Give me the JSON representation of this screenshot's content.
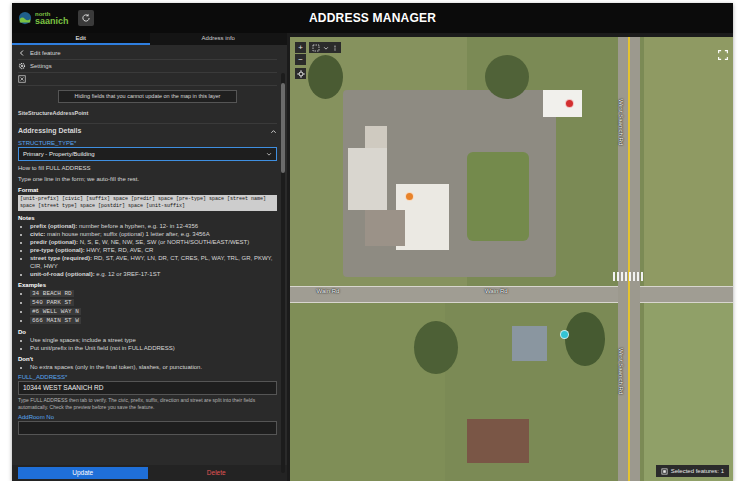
{
  "header": {
    "logo_top": "north",
    "logo_bottom": "saanich",
    "title": "ADDRESS MANAGER"
  },
  "panel": {
    "tabs": [
      {
        "label": "Edit",
        "selected": true
      },
      {
        "label": "Address info",
        "selected": false
      }
    ],
    "back_label": "Edit feature",
    "settings_label": "Settings",
    "notice": "Hiding fields that you cannot update on the map in this layer",
    "layer_name": "SiteStructureAddressPoint",
    "section": {
      "title": "Addressing Details",
      "expanded": true
    },
    "structure_type": {
      "label": "STRUCTURE_TYPE*",
      "value": "Primary - Property/Building"
    },
    "help": {
      "title": "How to fill FULL ADDRESS",
      "intro": "Type one line in the form; we auto-fill the rest.",
      "format_heading": "Format",
      "format": "[unit-prefix] [civic] [suffix] space [predir] space [pre-type] space [street name] space [street type] space [postdir] space [unit-suffix]",
      "notes_heading": "Notes",
      "notes": [
        {
          "term": "prefix (optional):",
          "text": " number before a hyphen, e.g. 12- in 12-4356"
        },
        {
          "term": "civic:",
          "text": " main house number; suffix (optional) 1 letter after, e.g. 3456A"
        },
        {
          "term": "predir (optional):",
          "text": " N, S, E, W, NE, NW, SE, SW (or NORTH/SOUTH/EAST/WEST)"
        },
        {
          "term": "pre-type (optional):",
          "text": " HWY, RTE, RD, AVE, CR"
        },
        {
          "term": "street type (required):",
          "text": " RD, ST, AVE, HWY, LN, DR, CT, CRES, PL, WAY, TRL, GR, PKWY, CIR, HWY"
        },
        {
          "term": "unit-of-road (optional):",
          "text": " e.g. 12 or 3REF-17-1ST"
        }
      ],
      "examples_heading": "Examples",
      "examples": [
        "34 BEACH RD",
        "540 PARK ST",
        "#6 WELL WAY N",
        "666 MAIN ST W"
      ],
      "do_heading": "Do",
      "do": [
        "Use single spaces; include a street type",
        "Put unit/prefix in the Unit field (not in FULL ADDRESS)"
      ],
      "dont_heading": "Don't",
      "dont": [
        "No extra spaces (only in the final token), slashes, or punctuation."
      ]
    },
    "full_address": {
      "label": "FULL_ADDRESS*",
      "value": "10344 WEST SAANICH RD",
      "hint": "Type FULL ADDRESS then tab to verify. The civic, prefix, suffix, direction and street are split into their fields automatically. Check the preview before you save the feature."
    },
    "room": {
      "label": "AddRoom No",
      "value": ""
    },
    "buttons": [
      {
        "label": "Update",
        "kind": "primary"
      },
      {
        "label": "Delete",
        "kind": "danger"
      }
    ]
  },
  "map": {
    "zoom_in": "+",
    "zoom_out": "−",
    "labels": [
      "Wain Rd",
      "Wain Rd",
      "West Saanich Rd",
      "West Saanich Rd"
    ],
    "pins": [
      {
        "color": "#e8832a"
      },
      {
        "color": "#d32f2f"
      },
      {
        "color": "#33c4d4"
      }
    ],
    "status": "Selected features: 1"
  }
}
